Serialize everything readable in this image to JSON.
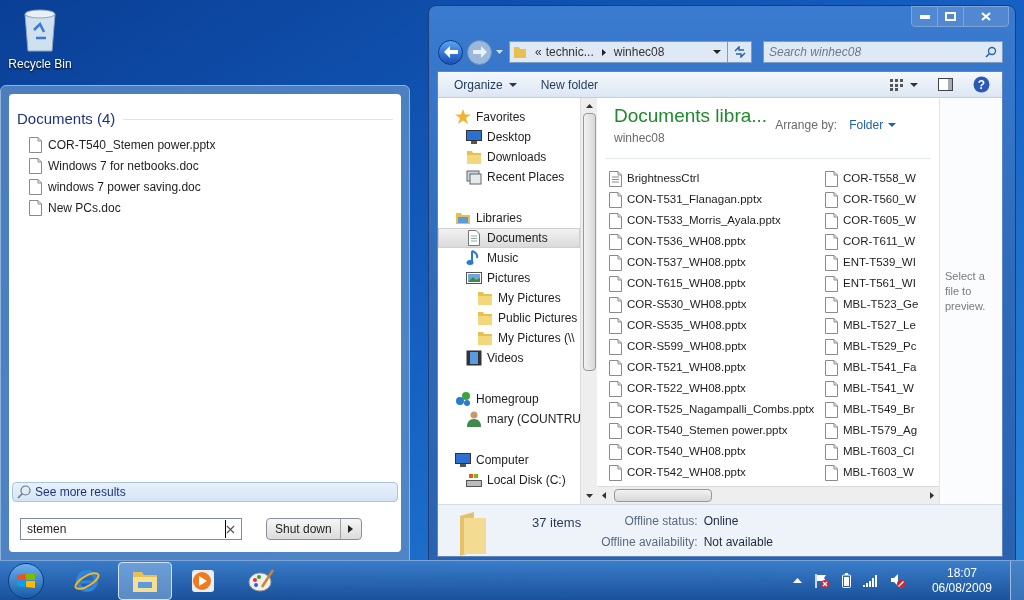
{
  "desktop_icons": [
    {
      "label": "Recycle Bin"
    }
  ],
  "start_menu": {
    "section_title": "Documents (4)",
    "results": [
      {
        "name": "COR-T540_Stemen power.pptx"
      },
      {
        "name": "Windows 7 for netbooks.doc"
      },
      {
        "name": "windows 7 power saving.doc"
      },
      {
        "name": "New PCs.doc"
      }
    ],
    "see_more": "See more results",
    "search": {
      "value": "stemen"
    },
    "shutdown": "Shut down"
  },
  "explorer": {
    "address": {
      "overflow": "«",
      "parent": "technic...",
      "current": "winhec08"
    },
    "search": {
      "placeholder": "Search winhec08"
    },
    "toolbar": [
      {
        "label": "Organize",
        "dropdown": true
      },
      {
        "label": "New folder",
        "dropdown": false
      }
    ],
    "nav": [
      {
        "label": "Favorites",
        "kind": "star",
        "selected": false,
        "children": [
          {
            "label": "Desktop",
            "kind": "monitor",
            "selected": false
          },
          {
            "label": "Downloads",
            "kind": "folder",
            "selected": false
          },
          {
            "label": "Recent Places",
            "kind": "places",
            "selected": false
          }
        ]
      },
      {
        "label": "Libraries",
        "kind": "library",
        "selected": false,
        "children": [
          {
            "label": "Documents",
            "kind": "document",
            "selected": true
          },
          {
            "label": "Music",
            "kind": "note",
            "selected": false
          },
          {
            "label": "Pictures",
            "kind": "picture",
            "selected": false,
            "children": [
              {
                "label": "My Pictures",
                "kind": "folder",
                "selected": false
              },
              {
                "label": "Public Pictures",
                "kind": "folder",
                "selected": false
              },
              {
                "label": "My Pictures (\\\\",
                "kind": "folder",
                "selected": false
              }
            ]
          },
          {
            "label": "Videos",
            "kind": "film",
            "selected": false
          }
        ]
      },
      {
        "label": "Homegroup",
        "kind": "homegroup",
        "selected": false,
        "children": [
          {
            "label": "mary (COUNTRU",
            "kind": "user",
            "selected": false
          }
        ]
      },
      {
        "label": "Computer",
        "kind": "monitor",
        "selected": false,
        "children": [
          {
            "label": "Local Disk (C:)",
            "kind": "disk",
            "selected": false
          }
        ]
      }
    ],
    "library": {
      "title": "Documents libra...",
      "subtitle": "winhec08",
      "arrange_label": "Arrange by:",
      "arrange_value": "Folder"
    },
    "files": [
      {
        "name": "BrightnessCtrl",
        "kind": "text"
      },
      {
        "name": "CON-T531_Flanagan.pptx",
        "kind": "file"
      },
      {
        "name": "CON-T533_Morris_Ayala.pptx",
        "kind": "file"
      },
      {
        "name": "CON-T536_WH08.pptx",
        "kind": "file"
      },
      {
        "name": "CON-T537_WH08.pptx",
        "kind": "file"
      },
      {
        "name": "CON-T615_WH08.pptx",
        "kind": "file"
      },
      {
        "name": "COR-S530_WH08.pptx",
        "kind": "file"
      },
      {
        "name": "COR-S535_WH08.pptx",
        "kind": "file"
      },
      {
        "name": "COR-S599_WH08.pptx",
        "kind": "file"
      },
      {
        "name": "COR-T521_WH08.pptx",
        "kind": "file"
      },
      {
        "name": "COR-T522_WH08.pptx",
        "kind": "file"
      },
      {
        "name": "COR-T525_Nagampalli_Combs.pptx",
        "kind": "file"
      },
      {
        "name": "COR-T540_Stemen power.pptx",
        "kind": "file"
      },
      {
        "name": "COR-T540_WH08.pptx",
        "kind": "file"
      },
      {
        "name": "COR-T542_WH08.pptx",
        "kind": "file"
      },
      {
        "name": "COR-T558_W",
        "kind": "file"
      },
      {
        "name": "COR-T560_W",
        "kind": "file"
      },
      {
        "name": "COR-T605_W",
        "kind": "file"
      },
      {
        "name": "COR-T611_W",
        "kind": "file"
      },
      {
        "name": "ENT-T539_WI",
        "kind": "file"
      },
      {
        "name": "ENT-T561_WI",
        "kind": "file"
      },
      {
        "name": "MBL-T523_Ge",
        "kind": "file"
      },
      {
        "name": "MBL-T527_Le",
        "kind": "file"
      },
      {
        "name": "MBL-T529_Pc",
        "kind": "file"
      },
      {
        "name": "MBL-T541_Fa",
        "kind": "file"
      },
      {
        "name": "MBL-T541_W",
        "kind": "file"
      },
      {
        "name": "MBL-T549_Br",
        "kind": "file"
      },
      {
        "name": "MBL-T579_Ag",
        "kind": "file"
      },
      {
        "name": "MBL-T603_Cl",
        "kind": "file"
      },
      {
        "name": "MBL-T603_W",
        "kind": "file"
      }
    ],
    "help": "?",
    "preview_text": "Select a file to preview.",
    "status": {
      "count": "37 items",
      "fields": [
        {
          "label": "Offline status:",
          "value": "Online"
        },
        {
          "label": "Offline availability:",
          "value": "Not available"
        }
      ]
    }
  },
  "taskbar": {
    "apps": [
      {
        "kind": "browser",
        "selected": false
      },
      {
        "kind": "explorer",
        "selected": true
      },
      {
        "kind": "media",
        "selected": false
      },
      {
        "kind": "paint",
        "selected": false
      }
    ],
    "clock": {
      "time": "18:07",
      "date": "06/08/2009"
    }
  }
}
